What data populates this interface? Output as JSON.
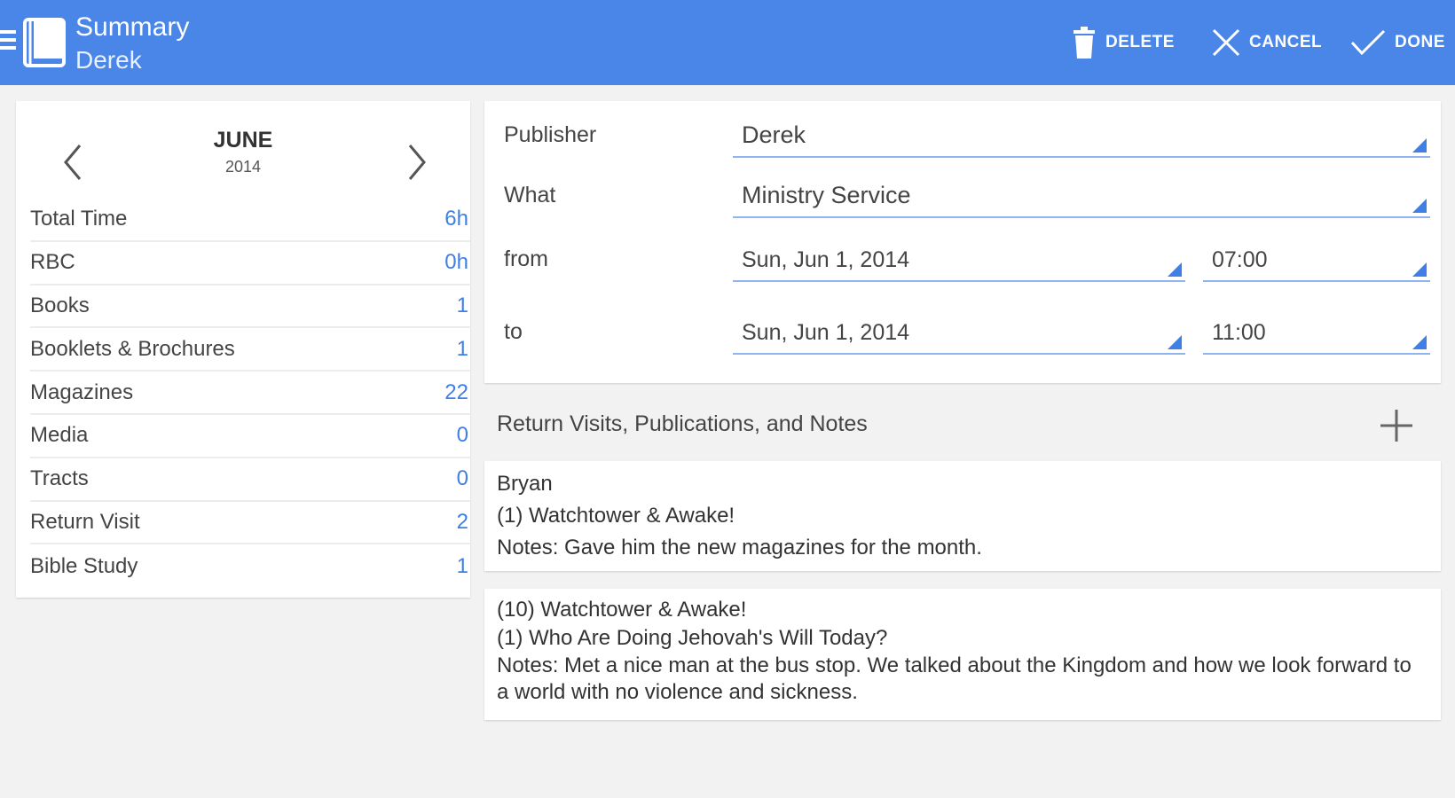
{
  "header": {
    "title": "Summary",
    "subtitle": "Derek",
    "actions": {
      "delete": "DELETE",
      "cancel": "CANCEL",
      "done": "DONE"
    },
    "color": "#4a86e8"
  },
  "summary": {
    "month": "JUNE",
    "year": "2014",
    "rows": [
      {
        "label": "Total Time",
        "value": "6h"
      },
      {
        "label": "RBC",
        "value": "0h"
      },
      {
        "label": "Books",
        "value": "1"
      },
      {
        "label": "Booklets & Brochures",
        "value": "1"
      },
      {
        "label": "Magazines",
        "value": "22"
      },
      {
        "label": "Media",
        "value": "0"
      },
      {
        "label": "Tracts",
        "value": "0"
      },
      {
        "label": "Return Visit",
        "value": "2"
      },
      {
        "label": "Bible Study",
        "value": "1"
      }
    ]
  },
  "form": {
    "publisher_label": "Publisher",
    "publisher_value": "Derek",
    "what_label": "What",
    "what_value": "Ministry Service",
    "from_label": "from",
    "from_date": "Sun, Jun 1, 2014",
    "from_time": "07:00",
    "to_label": "to",
    "to_date": "Sun, Jun 1, 2014",
    "to_time": "11:00"
  },
  "notes": {
    "section_title": "Return Visits, Publications, and Notes",
    "items": [
      {
        "lines": [
          "Bryan",
          "(1) Watchtower & Awake!",
          "Notes: Gave him the new magazines for the month."
        ]
      },
      {
        "lines": [
          "(10) Watchtower & Awake!",
          "(1) Who Are Doing Jehovah's Will Today?",
          "Notes: Met a nice man at the bus stop. We talked about the Kingdom and how we look forward to a world with no violence and sickness."
        ]
      }
    ]
  },
  "colors": {
    "accent": "#3f7fe6",
    "background": "#f2f2f2"
  }
}
